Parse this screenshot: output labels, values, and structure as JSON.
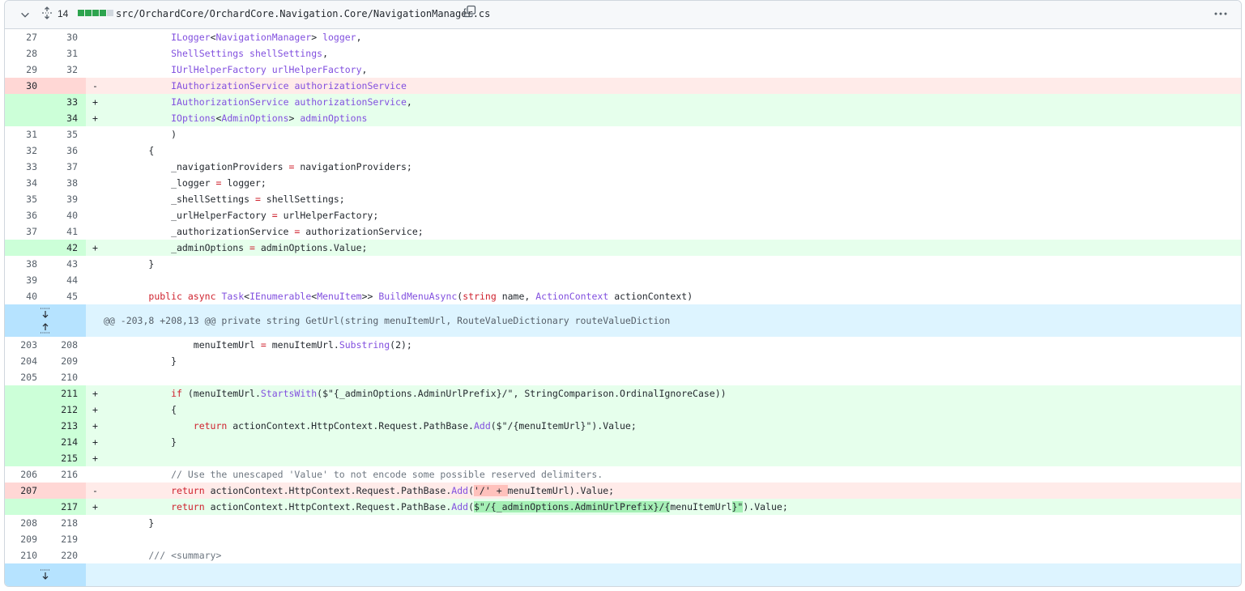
{
  "file_header": {
    "change_count": "14",
    "bars": [
      "#2da44e",
      "#2da44e",
      "#2da44e",
      "#2da44e",
      "#d0d7de"
    ],
    "path": "src/OrchardCore/OrchardCore.Navigation.Core/NavigationManager.cs"
  },
  "lines": [
    {
      "type": "ctx",
      "old": "27",
      "new": "30",
      "marker": "",
      "parts": [
        [
          "            ",
          ""
        ],
        [
          "ILogger<NavigationManager> logger",
          ""
        ],
        [
          ",",
          ""
        ]
      ]
    },
    {
      "type": "ctx",
      "old": "28",
      "new": "31",
      "marker": "",
      "parts": [
        [
          "            ",
          ""
        ],
        [
          "ShellSettings shellSettings",
          ""
        ],
        [
          ",",
          ""
        ]
      ]
    },
    {
      "type": "ctx",
      "old": "29",
      "new": "32",
      "marker": "",
      "parts": [
        [
          "            ",
          ""
        ],
        [
          "IUrlHelperFactory urlHelperFactory",
          ""
        ],
        [
          ",",
          ""
        ]
      ]
    },
    {
      "type": "del",
      "old": "30",
      "new": "",
      "marker": "-",
      "parts": [
        [
          "            ",
          ""
        ],
        [
          "IAuthorizationService authorizationService",
          ""
        ]
      ]
    },
    {
      "type": "add",
      "old": "",
      "new": "33",
      "marker": "+",
      "parts": [
        [
          "            ",
          ""
        ],
        [
          "IAuthorizationService authorizationService",
          ""
        ],
        [
          ",",
          ""
        ]
      ]
    },
    {
      "type": "add",
      "old": "",
      "new": "34",
      "marker": "+",
      "parts": [
        [
          "            ",
          ""
        ],
        [
          "IOptions<AdminOptions> adminOptions",
          ""
        ]
      ]
    },
    {
      "type": "ctx",
      "old": "31",
      "new": "35",
      "marker": "",
      "parts": [
        [
          "            )",
          ""
        ]
      ]
    },
    {
      "type": "ctx",
      "old": "32",
      "new": "36",
      "marker": "",
      "parts": [
        [
          "        {",
          ""
        ]
      ]
    },
    {
      "type": "ctx",
      "old": "33",
      "new": "37",
      "marker": "",
      "parts": [
        [
          "            _navigationProviders = navigationProviders;",
          ""
        ]
      ]
    },
    {
      "type": "ctx",
      "old": "34",
      "new": "38",
      "marker": "",
      "parts": [
        [
          "            _logger = logger;",
          ""
        ]
      ]
    },
    {
      "type": "ctx",
      "old": "35",
      "new": "39",
      "marker": "",
      "parts": [
        [
          "            _shellSettings = shellSettings;",
          ""
        ]
      ]
    },
    {
      "type": "ctx",
      "old": "36",
      "new": "40",
      "marker": "",
      "parts": [
        [
          "            _urlHelperFactory = urlHelperFactory;",
          ""
        ]
      ]
    },
    {
      "type": "ctx",
      "old": "37",
      "new": "41",
      "marker": "",
      "parts": [
        [
          "            _authorizationService = authorizationService;",
          ""
        ]
      ]
    },
    {
      "type": "add",
      "old": "",
      "new": "42",
      "marker": "+",
      "parts": [
        [
          "            _adminOptions = adminOptions.Value;",
          ""
        ]
      ]
    },
    {
      "type": "ctx",
      "old": "38",
      "new": "43",
      "marker": "",
      "parts": [
        [
          "        }",
          ""
        ]
      ]
    },
    {
      "type": "ctx",
      "old": "39",
      "new": "44",
      "marker": "",
      "parts": [
        [
          "",
          ""
        ]
      ]
    },
    {
      "type": "ctx",
      "old": "40",
      "new": "45",
      "marker": "",
      "parts": [
        [
          "        public async Task<IEnumerable<MenuItem>> BuildMenuAsync(string name, ActionContext actionContext)",
          ""
        ]
      ]
    }
  ],
  "hunk": {
    "text": "@@ -203,8 +208,13 @@ private string GetUrl(string menuItemUrl, RouteValueDictionary routeValueDiction"
  },
  "lines2": [
    {
      "type": "ctx",
      "old": "203",
      "new": "208",
      "marker": "",
      "parts": [
        [
          "                menuItemUrl = menuItemUrl.Substring(2);",
          ""
        ]
      ]
    },
    {
      "type": "ctx",
      "old": "204",
      "new": "209",
      "marker": "",
      "parts": [
        [
          "            }",
          ""
        ]
      ]
    },
    {
      "type": "ctx",
      "old": "205",
      "new": "210",
      "marker": "",
      "parts": [
        [
          "",
          ""
        ]
      ]
    },
    {
      "type": "add",
      "old": "",
      "new": "211",
      "marker": "+",
      "parts": [
        [
          "            if (menuItemUrl.StartsWith($\"{_adminOptions.AdminUrlPrefix}/\", StringComparison.OrdinalIgnoreCase))",
          ""
        ]
      ]
    },
    {
      "type": "add",
      "old": "",
      "new": "212",
      "marker": "+",
      "parts": [
        [
          "            {",
          ""
        ]
      ]
    },
    {
      "type": "add",
      "old": "",
      "new": "213",
      "marker": "+",
      "parts": [
        [
          "                return actionContext.HttpContext.Request.PathBase.Add($\"/{menuItemUrl}\").Value;",
          ""
        ]
      ]
    },
    {
      "type": "add",
      "old": "",
      "new": "214",
      "marker": "+",
      "parts": [
        [
          "            }",
          ""
        ]
      ]
    },
    {
      "type": "add",
      "old": "",
      "new": "215",
      "marker": "+",
      "parts": [
        [
          "",
          ""
        ]
      ]
    },
    {
      "type": "ctx",
      "old": "206",
      "new": "216",
      "marker": "",
      "parts": [
        [
          "            // Use the unescaped 'Value' to not encode some possible reserved delimiters.",
          ""
        ]
      ]
    },
    {
      "type": "del",
      "old": "207",
      "new": "",
      "marker": "-",
      "parts": [
        [
          "            return actionContext.HttpContext.Request.PathBase.Add(",
          ""
        ],
        [
          "'/' + ",
          "hl-del"
        ],
        [
          "menuItemUrl).Value;",
          ""
        ]
      ]
    },
    {
      "type": "add",
      "old": "",
      "new": "217",
      "marker": "+",
      "parts": [
        [
          "            return actionContext.HttpContext.Request.PathBase.Add(",
          ""
        ],
        [
          "$\"/{_adminOptions.AdminUrlPrefix}/{",
          "hl-add"
        ],
        [
          "menuItemUrl",
          ""
        ],
        [
          "}\"",
          "hl-add"
        ],
        [
          ").Value;",
          ""
        ]
      ]
    },
    {
      "type": "ctx",
      "old": "208",
      "new": "218",
      "marker": "",
      "parts": [
        [
          "        }",
          ""
        ]
      ]
    },
    {
      "type": "ctx",
      "old": "209",
      "new": "219",
      "marker": "",
      "parts": [
        [
          "",
          ""
        ]
      ]
    },
    {
      "type": "ctx",
      "old": "210",
      "new": "220",
      "marker": "",
      "parts": [
        [
          "        /// <summary>",
          ""
        ]
      ]
    }
  ]
}
